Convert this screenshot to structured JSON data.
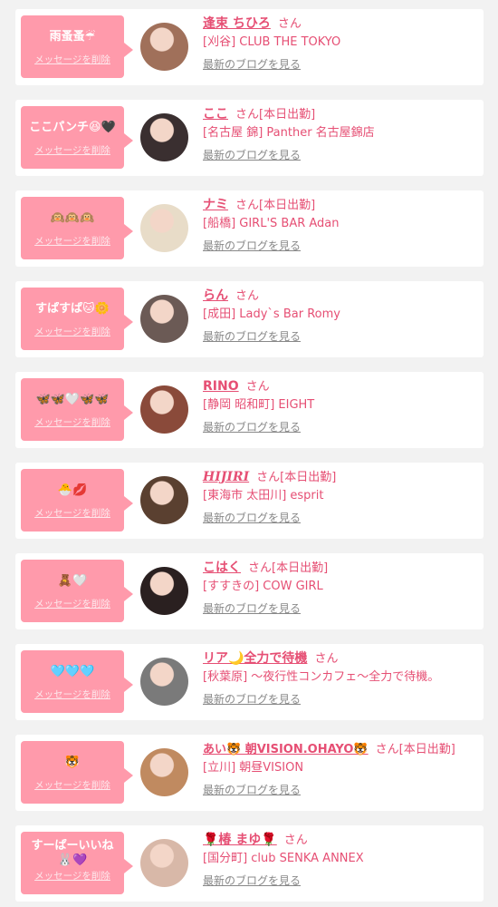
{
  "entries": [
    {
      "message": "雨蚤蚤☔",
      "delete_label": "メッセージを削除",
      "name": "逢束 ちひろ",
      "honorific": "さん",
      "status": "",
      "shop": "[刈谷] CLUB THE TOKYO",
      "blog_link": "最新のブログを見る",
      "avatar_color": "#a0705a"
    },
    {
      "message": "ここパンチ😆🖤",
      "delete_label": "メッセージを削除",
      "name": "ここ",
      "honorific": "さん",
      "status": "[本日出勤]",
      "shop": "[名古屋 錦] Panther 名古屋錦店",
      "blog_link": "最新のブログを見る",
      "avatar_color": "#3a2f30"
    },
    {
      "message": "🙉🙉🙉",
      "delete_label": "メッセージを削除",
      "name": "ナミ",
      "honorific": "さん",
      "status": "[本日出勤]",
      "shop": "[船橋] GIRL'S BAR Adan",
      "blog_link": "最新のブログを見る",
      "avatar_color": "#e8dcc8"
    },
    {
      "message": "すぱすぱ🐱🌼",
      "delete_label": "メッセージを削除",
      "name": "らん",
      "honorific": "さん",
      "status": "",
      "shop": "[成田] Lady`s Bar Romy",
      "blog_link": "最新のブログを見る",
      "avatar_color": "#6b5a55"
    },
    {
      "message": "🦋🦋🤍🦋🦋",
      "delete_label": "メッセージを削除",
      "name": "RINO",
      "honorific": "さん",
      "status": "",
      "shop": "[静岡 昭和町] EIGHT",
      "blog_link": "最新のブログを見る",
      "avatar_color": "#8a4a3a"
    },
    {
      "message": "🐣💋",
      "delete_label": "メッセージを削除",
      "name": "HIJIRI",
      "honorific": "さん",
      "status": "[本日出勤]",
      "shop": "[東海市 太田川] esprit",
      "blog_link": "最新のブログを見る",
      "avatar_color": "#5a4030"
    },
    {
      "message": "🧸🤍",
      "delete_label": "メッセージを削除",
      "name": "こはく",
      "honorific": "さん",
      "status": "[本日出勤]",
      "shop": "[すすきの] COW GIRL",
      "blog_link": "最新のブログを見る",
      "avatar_color": "#2a2020"
    },
    {
      "message": "🩵🩵🩵",
      "delete_label": "メッセージを削除",
      "name": "リア🌙全力で待機",
      "honorific": "さん",
      "status": "",
      "shop": "[秋葉原] 〜夜行性コンカフェ〜全力で待機。",
      "blog_link": "最新のブログを見る",
      "avatar_color": "#7a7a7a"
    },
    {
      "message": "🐯",
      "delete_label": "メッセージを削除",
      "name": "あい🐯 朝VISION.OHAYO🐯",
      "honorific": "さん",
      "status": "[本日出勤]",
      "shop": "[立川] 朝昼VISION",
      "blog_link": "最新のブログを見る",
      "avatar_color": "#c08a60"
    },
    {
      "message": "すーぱーいいね🐰💜",
      "delete_label": "メッセージを削除",
      "name": "🌹椿 まゆ🌹",
      "honorific": "さん",
      "status": "",
      "shop": "[国分町] club SENKA ANNEX",
      "blog_link": "最新のブログを見る",
      "avatar_color": "#d8b8a8"
    }
  ],
  "colors": {
    "accent": "#e64f74",
    "bubble": "#ff9aab",
    "background": "#f2f2f2"
  }
}
